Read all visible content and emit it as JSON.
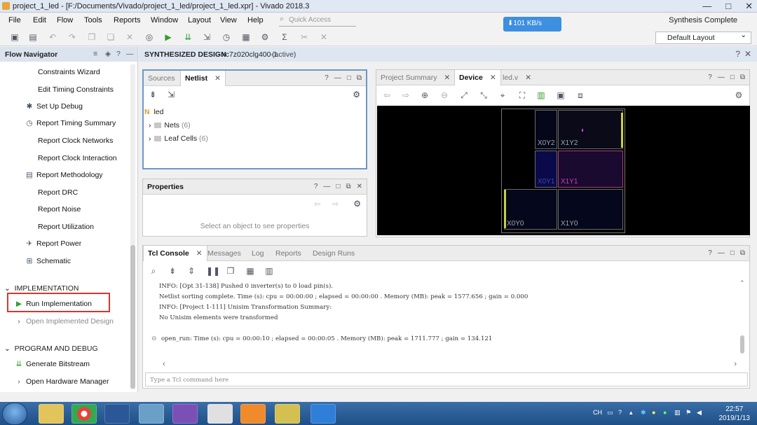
{
  "window": {
    "title": "project_1_led - [F:/Documents/Vivado/project_1_led/project_1_led.xpr] - Vivado 2018.3",
    "controls": [
      "—",
      "□",
      "✕"
    ]
  },
  "menu": [
    "File",
    "Edit",
    "Flow",
    "Tools",
    "Reports",
    "Window",
    "Layout",
    "View",
    "Help"
  ],
  "quick_access": "Quick Access",
  "status": "Synthesis Complete",
  "network": "⬇101 KB/s",
  "layout_select": "Default Layout",
  "nav": {
    "header": "Flow Navigator",
    "items": [
      "Constraints Wizard",
      "Edit Timing Constraints",
      "Set Up Debug",
      "Report Timing Summary",
      "Report Clock Networks",
      "Report Clock Interaction",
      "Report Methodology",
      "Report DRC",
      "Report Noise",
      "Report Utilization",
      "Report Power",
      "Schematic"
    ],
    "impl_section": "IMPLEMENTATION",
    "run_impl": "Run Implementation",
    "open_impl": "Open Implemented Design",
    "prog_section": "PROGRAM AND DEBUG",
    "gen_bit": "Generate Bitstream",
    "open_hw": "Open Hardware Manager"
  },
  "banner": {
    "title": "SYNTHESIZED DESIGN",
    "part": "- xc7z020clg400-1",
    "state": "(active)"
  },
  "sources": {
    "tabs": [
      "Sources",
      "Netlist"
    ],
    "root": "led",
    "nets_label": "Nets",
    "nets_count": "(6)",
    "cells_label": "Leaf Cells",
    "cells_count": "(6)"
  },
  "properties": {
    "title": "Properties",
    "empty": "Select an object to see properties"
  },
  "device": {
    "tabs": [
      "Project Summary",
      "Device",
      "led.v"
    ],
    "regions": [
      "X0Y2",
      "X1Y2",
      "X0Y1",
      "X1Y1",
      "X0Y0",
      "X1Y0"
    ]
  },
  "console": {
    "tabs": [
      "Tcl Console",
      "Messages",
      "Log",
      "Reports",
      "Design Runs"
    ],
    "lines": [
      "INFO: [Opt 31-138] Pushed 0 inverter(s) to 0 load pin(s).",
      "Netlist sorting complete. Time (s): cpu = 00:00:00 ; elapsed = 00:00:00 . Memory (MB): peak = 1577.656 ; gain = 0.000",
      "INFO: [Project 1-111] Unisim Transformation Summary:",
      "No Unisim elements were transformed",
      "open_run: Time (s): cpu = 00:00:10 ; elapsed = 00:00:05 . Memory (MB): peak = 1711.777 ; gain = 134.121"
    ],
    "placeholder": "Type a Tcl command here"
  },
  "taskbar": {
    "lang": "CH",
    "time": "22:57",
    "date": "2019/1/13"
  }
}
